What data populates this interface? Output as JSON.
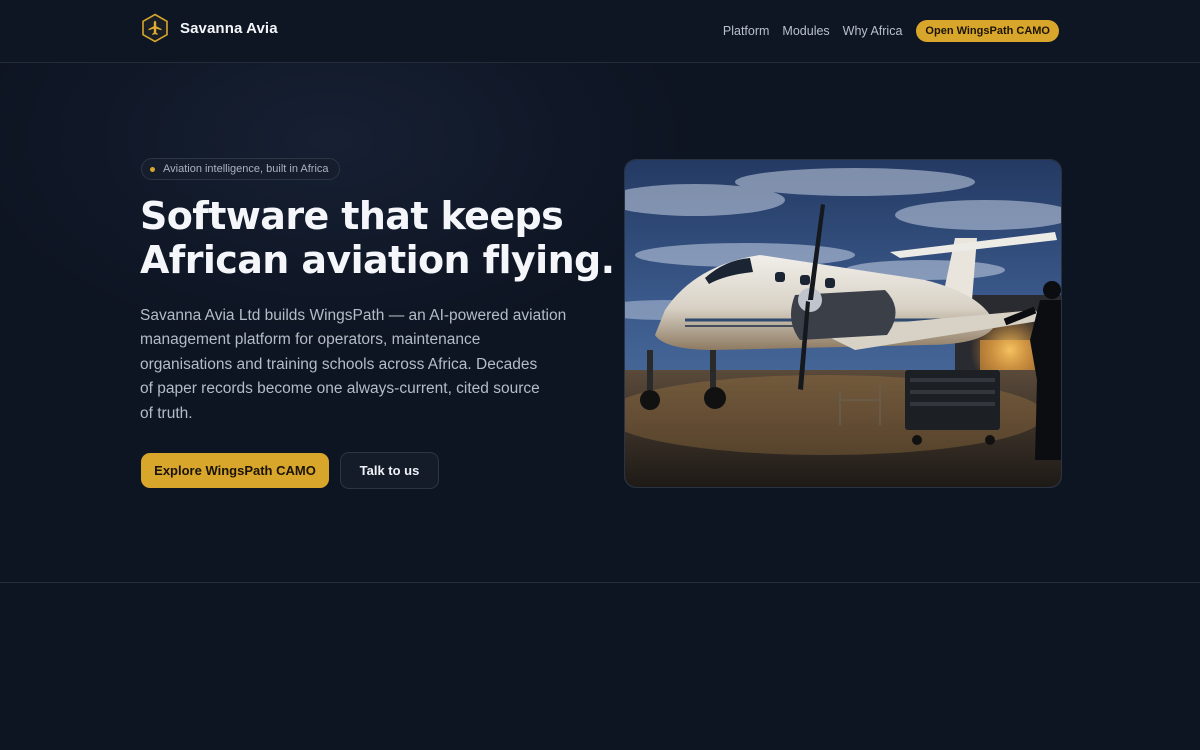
{
  "header": {
    "brand_name": "Savanna Avia",
    "nav": [
      "Platform",
      "Modules",
      "Why Africa"
    ],
    "cta_label": "Open WingsPath CAMO"
  },
  "hero": {
    "badge": "Aviation intelligence, built in Africa",
    "headline_lines": [
      "Software that keeps",
      "African aviation flying."
    ],
    "description_lines": [
      "Savanna Avia Ltd builds WingsPath — an AI-powered aviation",
      "management platform for operators, maintenance",
      "organisations and training schools across Africa. Decades",
      "of paper records become one always-current, cited source",
      "of truth."
    ],
    "primary_button": "Explore WingsPath CAMO",
    "secondary_button": "Talk to us"
  },
  "colors": {
    "background": "#0d1422",
    "accent": "#d9a62c",
    "border": "#232c3b"
  },
  "icons": {
    "logo": "airplane-hexagon-logo-icon",
    "badge_dot": "status-dot-icon"
  }
}
